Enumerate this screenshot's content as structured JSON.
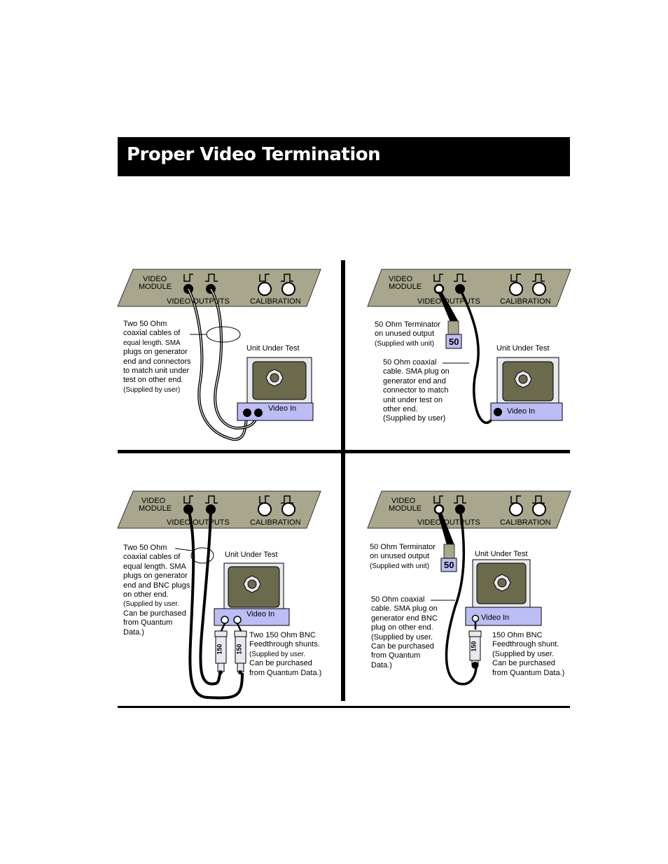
{
  "header": {
    "title": "Proper Video Termination"
  },
  "panel": {
    "module_label_line1": "VIDEO",
    "module_label_line2": "MODULE",
    "video_outputs_label": "VIDEO OUTPUTS",
    "calibration_label": "CALIBRATION"
  },
  "uut": {
    "title": "Unit Under Test",
    "video_in": "Video In"
  },
  "quadrants": [
    {
      "id": "top-left",
      "description_lines": [
        "Two 50 Ohm",
        "coaxial cables of",
        "equal length. SMA",
        "plugs on generator",
        "end and connectors",
        "to match unit under",
        "test on other end.",
        "(Supplied by user)"
      ]
    },
    {
      "id": "top-right",
      "terminator_lines": [
        "50 Ohm Terminator",
        "on unused output",
        "(Supplied with unit)"
      ],
      "terminator_value": "50",
      "description_lines": [
        "50 Ohm coaxial",
        "cable. SMA plug on",
        "generator end and",
        "connector to match",
        "unit under test on",
        "other end.",
        "(Supplied by user)"
      ]
    },
    {
      "id": "bottom-left",
      "description_lines": [
        "Two 50 Ohm",
        "coaxial cables of",
        "equal length. SMA",
        "plugs on generator",
        "end and BNC plugs",
        "on other end.",
        "(Supplied by user.",
        "Can be purchased",
        "from Quantum",
        "Data.)"
      ],
      "shunt_value": "150",
      "shunt_lines": [
        "Two 150 Ohm BNC",
        "Feedthrough shunts.",
        "(Supplied by user.",
        "Can be purchased",
        "from Quantum Data.)"
      ]
    },
    {
      "id": "bottom-right",
      "terminator_lines": [
        "50 Ohm Terminator",
        "on unused output",
        "(Supplied with unit)"
      ],
      "terminator_value": "50",
      "description_lines": [
        "50 Ohm coaxial",
        "cable. SMA plug on",
        "generator end BNC",
        "plug on other end.",
        "(Supplied by user.",
        "Can be purchased",
        "from Quantum",
        "Data.)"
      ],
      "shunt_value": "150",
      "shunt_lines": [
        "150 Ohm BNC",
        "Feedthrough shunt.",
        "(Supplied by user.",
        "Can be purchased",
        "from Quantum Data.)"
      ]
    }
  ],
  "colors": {
    "panel_fill": "#a8a68c",
    "uut_screen": "#6b6a4c",
    "uut_base": "#bdbdf5",
    "terminator_fill": "#bdbdf5"
  }
}
